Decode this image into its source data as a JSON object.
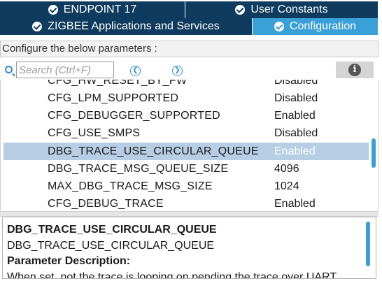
{
  "tabs": {
    "row1": [
      {
        "label": "ENDPOINT 17",
        "active": false
      },
      {
        "label": "User Constants",
        "active": false
      }
    ],
    "row2": [
      {
        "label": "ZIGBEE Applications and Services",
        "active": false
      },
      {
        "label": "Configuration",
        "active": true
      }
    ]
  },
  "instructions": "Configure the below parameters :",
  "search": {
    "placeholder": "Search (Ctrl+F)",
    "value": ""
  },
  "nav": {
    "prev_icon": "chevron-left-icon",
    "next_icon": "chevron-right-icon"
  },
  "info_icon": "i",
  "parameters": [
    {
      "name": "CFG_HW_RESET_BY_FW",
      "value": "Disabled"
    },
    {
      "name": "CFG_LPM_SUPPORTED",
      "value": "Disabled"
    },
    {
      "name": "CFG_DEBUGGER_SUPPORTED",
      "value": "Enabled"
    },
    {
      "name": "CFG_USE_SMPS",
      "value": "Disabled"
    },
    {
      "name": "DBG_TRACE_USE_CIRCULAR_QUEUE",
      "value": "Enabled"
    },
    {
      "name": "DBG_TRACE_MSG_QUEUE_SIZE",
      "value": "4096"
    },
    {
      "name": "MAX_DBG_TRACE_MSG_SIZE",
      "value": "1024"
    },
    {
      "name": "CFG_DEBUG_TRACE",
      "value": "Enabled"
    }
  ],
  "selected_parameter": "DBG_TRACE_USE_CIRCULAR_QUEUE",
  "description": {
    "title": "DBG_TRACE_USE_CIRCULAR_QUEUE",
    "subtitle": "DBG_TRACE_USE_CIRCULAR_QUEUE",
    "heading": "Parameter Description:",
    "body": "When set, not the trace is looping on pending the trace over UART"
  },
  "colors": {
    "tab_bg": "#0f3b5e",
    "tab_active_bg": "#3aa0d8",
    "selection_bg": "#b7cde3",
    "accent": "#3aa0d8"
  }
}
